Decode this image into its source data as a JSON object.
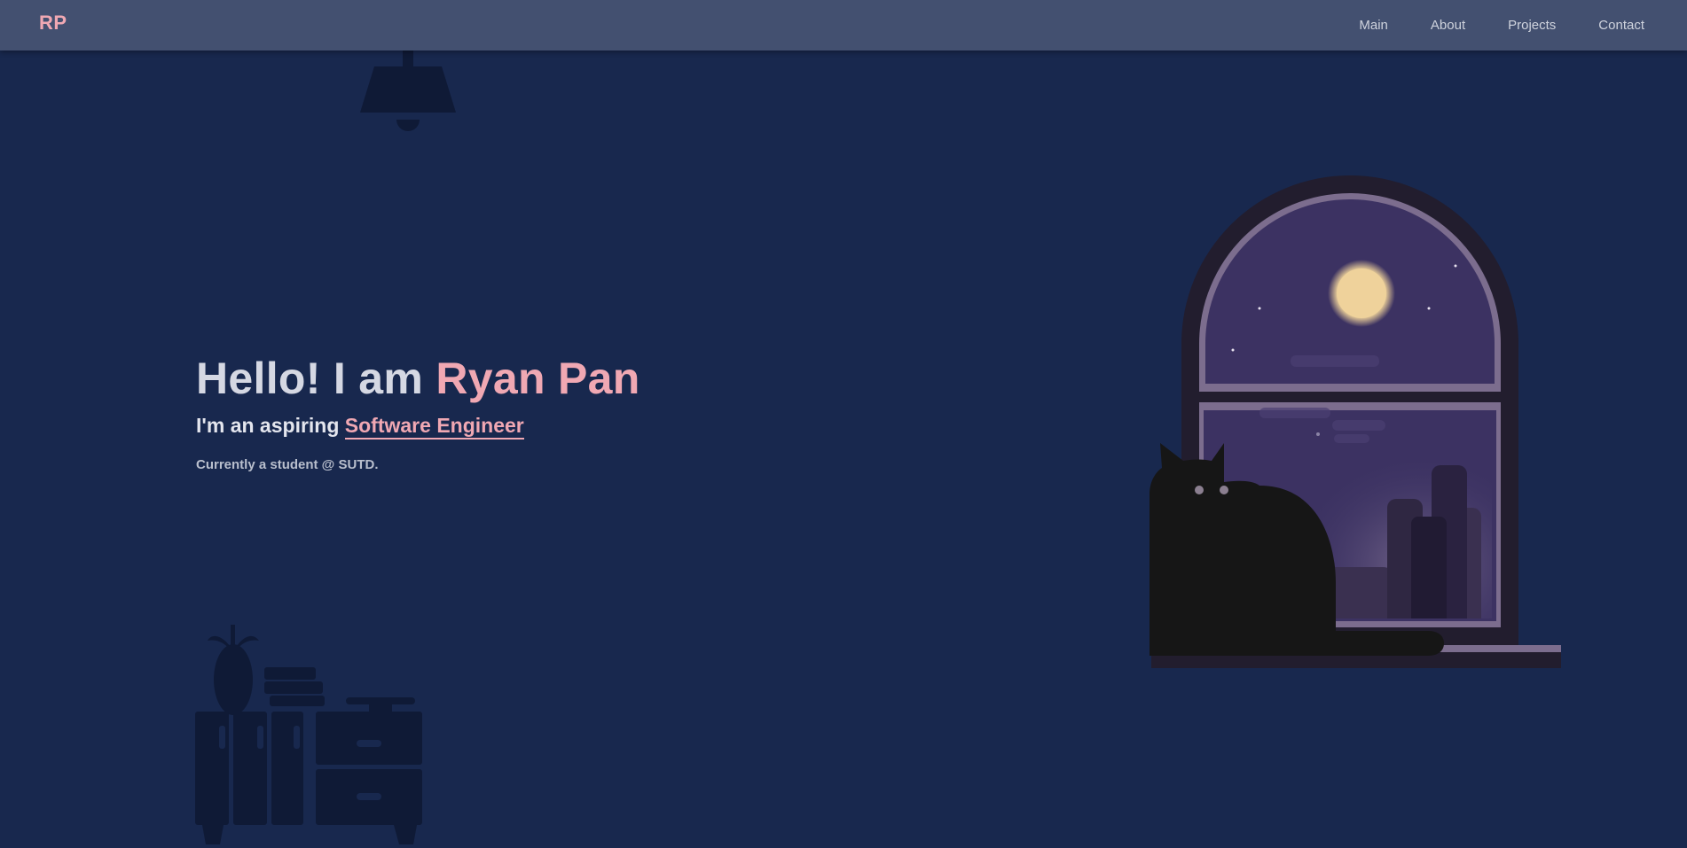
{
  "nav": {
    "logo": "RP",
    "links": [
      "Main",
      "About",
      "Projects",
      "Contact"
    ]
  },
  "hero": {
    "greeting": "Hello! I am ",
    "name": "Ryan Pan",
    "tagline_prefix": "I'm an aspiring ",
    "role": "Software Engineer",
    "status": "Currently a student @ SUTD."
  },
  "colors": {
    "background": "#18284e",
    "navbar": "#435070",
    "accent": "#f0a8b3",
    "silhouette": "#0f1a36"
  },
  "illustrations": [
    "ceiling-lamp-icon",
    "dresser-plant-icon",
    "night-window-icon",
    "cat-icon"
  ]
}
